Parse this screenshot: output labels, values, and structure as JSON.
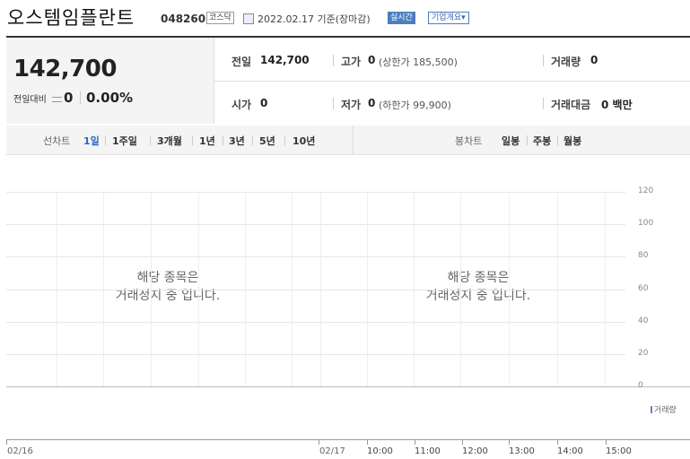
{
  "header": {
    "stock_name": "오스템임플란트",
    "stock_code": "048260",
    "market": "코스닥",
    "base_date": "2022.02.17 기준(장마감)",
    "realtime_label": "실시간",
    "overview_label": "기업개요"
  },
  "quote": {
    "price": "142,700",
    "change_label": "전일대비",
    "change_value": "0",
    "change_rate": "0.00%",
    "prev_close_label": "전일",
    "prev_close": "142,700",
    "high_label": "고가",
    "high": "0",
    "upper_limit": "(상한가 185,500)",
    "volume_label": "거래량",
    "volume": "0",
    "open_label": "시가",
    "open": "0",
    "low_label": "저가",
    "low": "0",
    "lower_limit": "(하한가 99,900)",
    "amount_label": "거래대금",
    "amount": "0 백만"
  },
  "period_tabs": {
    "label": "선차트",
    "items": [
      "1일",
      "1주일",
      "3개월",
      "1년",
      "3년",
      "5년",
      "10년"
    ],
    "active_index": 0
  },
  "candle_tabs": {
    "label": "봉차트",
    "items": [
      "일봉",
      "주봉",
      "월봉"
    ]
  },
  "chart_data": {
    "type": "line",
    "panels": [
      {
        "message_line1": "해당 종목은",
        "message_line2": "거래정지 중 입니다."
      },
      {
        "message_line1": "해당 종목은",
        "message_line2": "거래정지 중 입니다."
      }
    ],
    "y_ticks": [
      "120",
      "100",
      "80",
      "60",
      "40",
      "20",
      "0"
    ],
    "ylim": [
      0,
      120
    ],
    "x_ticks": [
      "02/16",
      "02/17",
      "10:00",
      "11:00",
      "12:00",
      "13:00",
      "14:00",
      "15:00"
    ],
    "legend": "거래량",
    "grid": true,
    "series": []
  },
  "colors": {
    "accent": "#2a64c4",
    "realtime_badge": "#4a7fc1",
    "volume_legend": "#9966cc"
  }
}
